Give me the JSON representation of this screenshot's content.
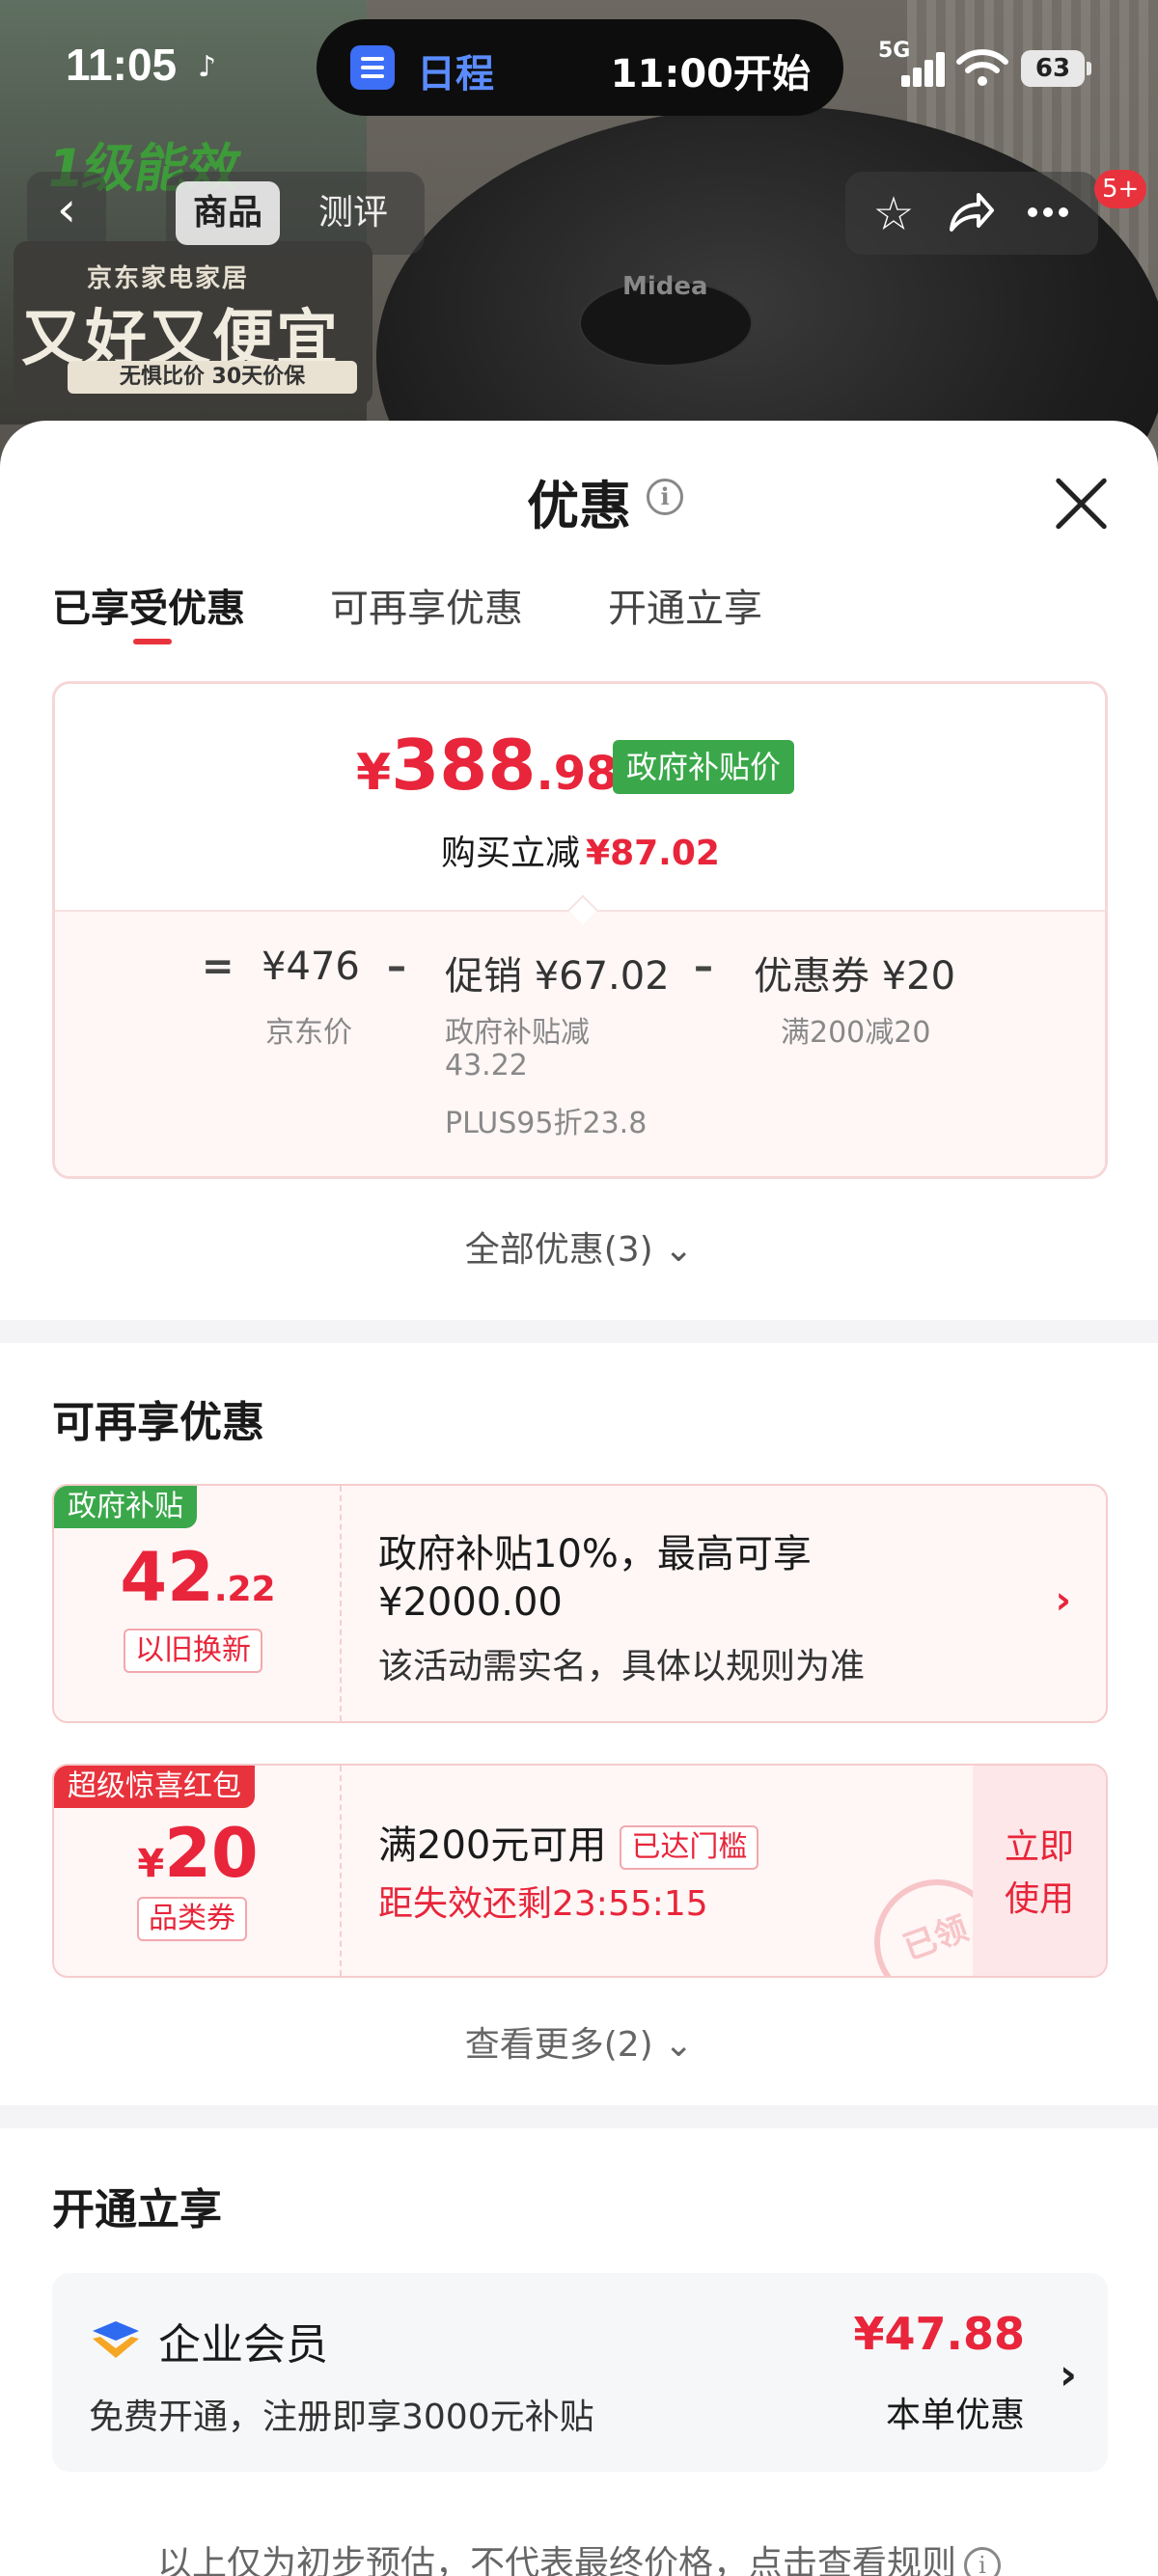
{
  "status_bar": {
    "time": "11:05",
    "schedule_label": "日程",
    "schedule_time": "11:00开始",
    "network": "5G",
    "battery": "63"
  },
  "background": {
    "energy_label": "1级能效",
    "banner_top": "京东家电家居",
    "banner_main": "又好又便宜",
    "banner_sub": "无惧比价 30天价保",
    "product_brand": "Midea"
  },
  "nav": {
    "tabs": [
      "商品",
      "测评"
    ],
    "badge": "5+"
  },
  "sheet": {
    "title": "优惠",
    "tabs": [
      "已享受优惠",
      "可再享优惠",
      "开通立享"
    ],
    "active_tab": 0
  },
  "price_card": {
    "yen": "¥",
    "price_int": "388",
    "price_dec": ".98",
    "tag": "政府补贴价",
    "reduce_label": "购买立减",
    "reduce_amount": "¥87.02",
    "calc": {
      "eq": "=",
      "jd_price": "¥476",
      "jd_label": "京东价",
      "minus": "–",
      "promo": "促销 ¥67.02",
      "promo_sub1": "政府补贴减",
      "promo_sub2": "43.22",
      "promo_sub3": "PLUS95折23.8",
      "coupon": "优惠券 ¥20",
      "coupon_sub": "满200减20"
    },
    "all_offers": "全部优惠(3)"
  },
  "more_offers": {
    "title": "可再享优惠",
    "gov": {
      "tag": "政府补贴",
      "amount_int": "42",
      "amount_dec": ".22",
      "badge": "以旧换新",
      "line1": "政府补贴10%，最高可享",
      "line2": "¥2000.00",
      "line3": "该活动需实名，具体以规则为准"
    },
    "redpacket": {
      "tag": "超级惊喜红包",
      "yen": "¥",
      "amount": "20",
      "badge": "品类券",
      "line1": "满200元可用",
      "reached": "已达门槛",
      "countdown": "距失效还剩23:55:15",
      "use_line1": "立即",
      "use_line2": "使用",
      "stamp": "已领"
    },
    "see_more": "查看更多(2)"
  },
  "open_now": {
    "title": "开通立享",
    "member_name": "企业会员",
    "member_desc": "免费开通，注册即享3000元补贴",
    "member_price": "¥47.88",
    "member_price_label": "本单优惠"
  },
  "footer": {
    "note": "以上仅为初步预估，不代表最终价格，点击查看规则"
  },
  "colors": {
    "accent_red": "#e8253a",
    "gov_green": "#3aa84a",
    "island_blue": "#3d6ef6"
  }
}
